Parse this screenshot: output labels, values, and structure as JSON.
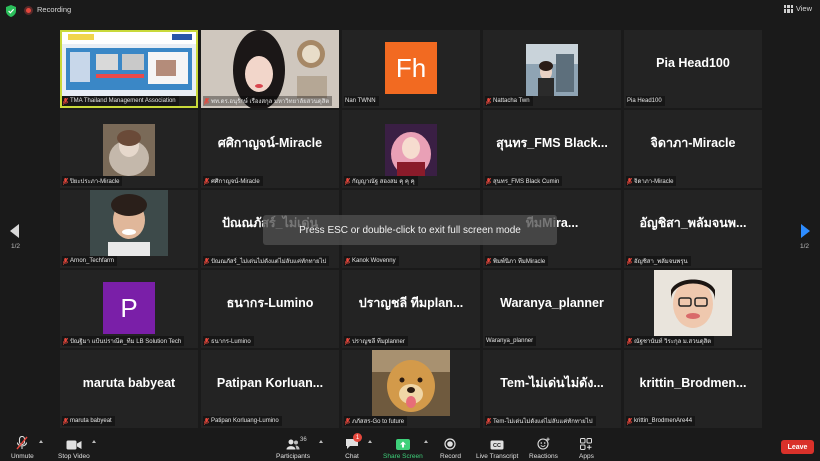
{
  "topbar": {
    "recording_label": "Recording",
    "view_label": "View"
  },
  "overlay": {
    "esc_message": "Press ESC or double-click to exit full screen mode"
  },
  "pagination": {
    "left": "1/2",
    "right": "1/2"
  },
  "colors": {
    "active_border": "#c9d93a",
    "recording": "#e5473c",
    "page_arrow_active": "#2d8cff",
    "leave": "#d9312a",
    "share_green": "#3ed07a"
  },
  "tiles": [
    {
      "kind": "screenshare",
      "big": "",
      "name": "TMA Thailand Management Association",
      "muted": true
    },
    {
      "kind": "photo",
      "big": "",
      "name": "พท.ดร.อนุรักษ์ เรืองสกุล มหาวิทยาลัยสวนดุสิต",
      "muted": true
    },
    {
      "kind": "avatar",
      "big": "Fh",
      "avatar_color": "#f26a21",
      "name": "Nan TWNN",
      "muted": false
    },
    {
      "kind": "photo",
      "big": "",
      "name": "Nattacha Twn",
      "muted": true
    },
    {
      "kind": "text",
      "big": "Pia Head100",
      "name": "Pia Head100",
      "muted": false
    },
    {
      "kind": "photo",
      "big": "",
      "name": "ปิยะประภา-Miracle",
      "muted": true
    },
    {
      "kind": "text",
      "big": "ศศิกาญจน์-Miracle",
      "name": "ศศิกาญจน์-Miracle",
      "muted": true
    },
    {
      "kind": "photo",
      "big": "",
      "name": "กัญญาณัฐ สองสม คุ คุ คุ",
      "muted": true
    },
    {
      "kind": "text",
      "big": "สุนทร_FMS Black...",
      "name": "สุนทร_FMS Black Cumin",
      "muted": true
    },
    {
      "kind": "text",
      "big": "จิดาภา-Miracle",
      "name": "จิดาภา-Miracle",
      "muted": true
    },
    {
      "kind": "photo",
      "big": "",
      "name": "Arnon_Techfarm",
      "muted": true
    },
    {
      "kind": "text",
      "big": "ปัณณภัสร์_ไม่เด่น",
      "name": "ปัณณภัสร์_ไม่เด่นไม่ดังแต่ไม่ลับแค่ทักทายไป",
      "muted": true
    },
    {
      "kind": "text",
      "big": "",
      "name": "Kanok Wovenny",
      "muted": true
    },
    {
      "kind": "text",
      "big": "ทีมMira...",
      "name": "พิมพ์นิภา ทีมMiracle",
      "muted": true
    },
    {
      "kind": "text",
      "big": "อัญชิสา_พลัมจนพ...",
      "name": "อัญชิสา_พลัมจนพรุน",
      "muted": true
    },
    {
      "kind": "avatar",
      "big": "P",
      "avatar_color": "#7a1fa8",
      "name": "ปัณฐิมา แป้นปราณีต_ทีม LB Solution Tech",
      "muted": true
    },
    {
      "kind": "text",
      "big": "ธนากร-Lumino",
      "name": "ธนากร-Lumino",
      "muted": true
    },
    {
      "kind": "text",
      "big": "ปราญชลี ทีมplan...",
      "name": "ปราญชลี ทีมplanner",
      "muted": true
    },
    {
      "kind": "text",
      "big": "Waranya_planner",
      "name": "Waranya_planner",
      "muted": false
    },
    {
      "kind": "photo",
      "big": "",
      "name": "ณัฐชานันท์ วิระกุล ม.สวนดุสิต",
      "muted": true
    },
    {
      "kind": "text",
      "big": "maruta babyeat",
      "name": "maruta babyeat",
      "muted": true
    },
    {
      "kind": "text",
      "big": "Patipan Korluan...",
      "name": "Patipan Korluang-Lumino",
      "muted": true
    },
    {
      "kind": "photo",
      "big": "",
      "name": "ภภัสสร-Go to future",
      "muted": true
    },
    {
      "kind": "text",
      "big": "Tem-ไม่เด่นไม่ดัง...",
      "name": "Tem-ไม่เด่นไม่ดังแต่ไม่ลับแค่ทักทายไป",
      "muted": true
    },
    {
      "kind": "text",
      "big": "krittin_Brodmen...",
      "name": "krittin_BrodmenAre44",
      "muted": true
    }
  ],
  "controls": {
    "unmute": "Unmute",
    "stop_video": "Stop Video",
    "participants": "Participants",
    "participants_count": "36",
    "chat": "Chat",
    "chat_badge": "1",
    "share_screen": "Share Screen",
    "record": "Record",
    "live_transcript": "Live Transcript",
    "reactions": "Reactions",
    "apps": "Apps",
    "leave": "Leave"
  }
}
